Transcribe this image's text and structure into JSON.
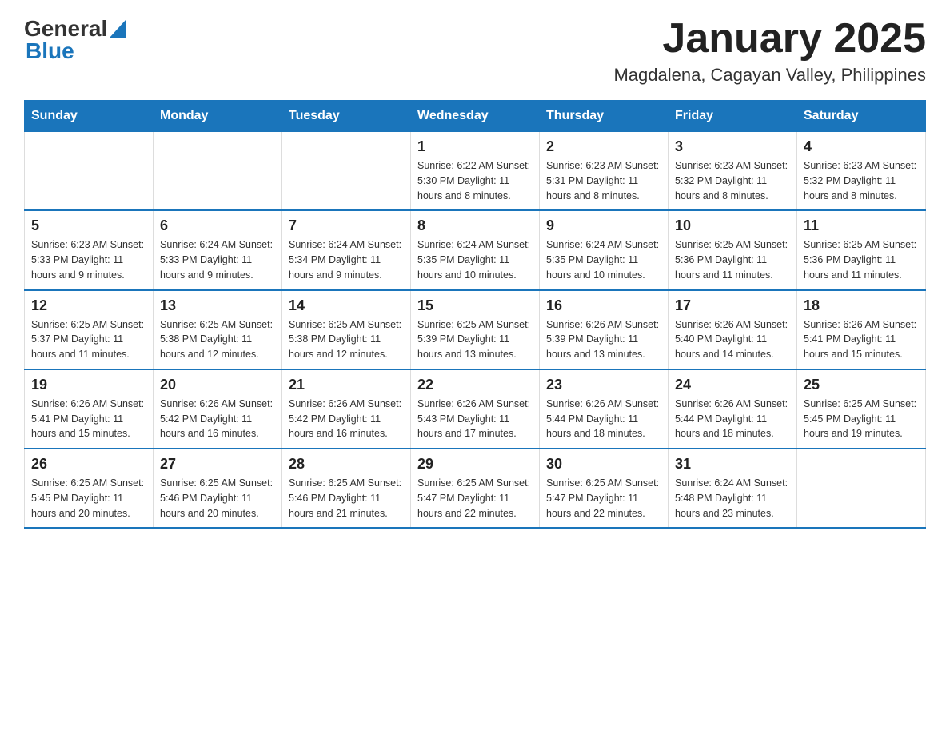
{
  "header": {
    "logo": {
      "general": "General",
      "blue": "Blue"
    },
    "title": "January 2025",
    "subtitle": "Magdalena, Cagayan Valley, Philippines"
  },
  "days_of_week": [
    "Sunday",
    "Monday",
    "Tuesday",
    "Wednesday",
    "Thursday",
    "Friday",
    "Saturday"
  ],
  "weeks": [
    [
      {
        "day": "",
        "info": ""
      },
      {
        "day": "",
        "info": ""
      },
      {
        "day": "",
        "info": ""
      },
      {
        "day": "1",
        "info": "Sunrise: 6:22 AM\nSunset: 5:30 PM\nDaylight: 11 hours and 8 minutes."
      },
      {
        "day": "2",
        "info": "Sunrise: 6:23 AM\nSunset: 5:31 PM\nDaylight: 11 hours and 8 minutes."
      },
      {
        "day": "3",
        "info": "Sunrise: 6:23 AM\nSunset: 5:32 PM\nDaylight: 11 hours and 8 minutes."
      },
      {
        "day": "4",
        "info": "Sunrise: 6:23 AM\nSunset: 5:32 PM\nDaylight: 11 hours and 8 minutes."
      }
    ],
    [
      {
        "day": "5",
        "info": "Sunrise: 6:23 AM\nSunset: 5:33 PM\nDaylight: 11 hours and 9 minutes."
      },
      {
        "day": "6",
        "info": "Sunrise: 6:24 AM\nSunset: 5:33 PM\nDaylight: 11 hours and 9 minutes."
      },
      {
        "day": "7",
        "info": "Sunrise: 6:24 AM\nSunset: 5:34 PM\nDaylight: 11 hours and 9 minutes."
      },
      {
        "day": "8",
        "info": "Sunrise: 6:24 AM\nSunset: 5:35 PM\nDaylight: 11 hours and 10 minutes."
      },
      {
        "day": "9",
        "info": "Sunrise: 6:24 AM\nSunset: 5:35 PM\nDaylight: 11 hours and 10 minutes."
      },
      {
        "day": "10",
        "info": "Sunrise: 6:25 AM\nSunset: 5:36 PM\nDaylight: 11 hours and 11 minutes."
      },
      {
        "day": "11",
        "info": "Sunrise: 6:25 AM\nSunset: 5:36 PM\nDaylight: 11 hours and 11 minutes."
      }
    ],
    [
      {
        "day": "12",
        "info": "Sunrise: 6:25 AM\nSunset: 5:37 PM\nDaylight: 11 hours and 11 minutes."
      },
      {
        "day": "13",
        "info": "Sunrise: 6:25 AM\nSunset: 5:38 PM\nDaylight: 11 hours and 12 minutes."
      },
      {
        "day": "14",
        "info": "Sunrise: 6:25 AM\nSunset: 5:38 PM\nDaylight: 11 hours and 12 minutes."
      },
      {
        "day": "15",
        "info": "Sunrise: 6:25 AM\nSunset: 5:39 PM\nDaylight: 11 hours and 13 minutes."
      },
      {
        "day": "16",
        "info": "Sunrise: 6:26 AM\nSunset: 5:39 PM\nDaylight: 11 hours and 13 minutes."
      },
      {
        "day": "17",
        "info": "Sunrise: 6:26 AM\nSunset: 5:40 PM\nDaylight: 11 hours and 14 minutes."
      },
      {
        "day": "18",
        "info": "Sunrise: 6:26 AM\nSunset: 5:41 PM\nDaylight: 11 hours and 15 minutes."
      }
    ],
    [
      {
        "day": "19",
        "info": "Sunrise: 6:26 AM\nSunset: 5:41 PM\nDaylight: 11 hours and 15 minutes."
      },
      {
        "day": "20",
        "info": "Sunrise: 6:26 AM\nSunset: 5:42 PM\nDaylight: 11 hours and 16 minutes."
      },
      {
        "day": "21",
        "info": "Sunrise: 6:26 AM\nSunset: 5:42 PM\nDaylight: 11 hours and 16 minutes."
      },
      {
        "day": "22",
        "info": "Sunrise: 6:26 AM\nSunset: 5:43 PM\nDaylight: 11 hours and 17 minutes."
      },
      {
        "day": "23",
        "info": "Sunrise: 6:26 AM\nSunset: 5:44 PM\nDaylight: 11 hours and 18 minutes."
      },
      {
        "day": "24",
        "info": "Sunrise: 6:26 AM\nSunset: 5:44 PM\nDaylight: 11 hours and 18 minutes."
      },
      {
        "day": "25",
        "info": "Sunrise: 6:25 AM\nSunset: 5:45 PM\nDaylight: 11 hours and 19 minutes."
      }
    ],
    [
      {
        "day": "26",
        "info": "Sunrise: 6:25 AM\nSunset: 5:45 PM\nDaylight: 11 hours and 20 minutes."
      },
      {
        "day": "27",
        "info": "Sunrise: 6:25 AM\nSunset: 5:46 PM\nDaylight: 11 hours and 20 minutes."
      },
      {
        "day": "28",
        "info": "Sunrise: 6:25 AM\nSunset: 5:46 PM\nDaylight: 11 hours and 21 minutes."
      },
      {
        "day": "29",
        "info": "Sunrise: 6:25 AM\nSunset: 5:47 PM\nDaylight: 11 hours and 22 minutes."
      },
      {
        "day": "30",
        "info": "Sunrise: 6:25 AM\nSunset: 5:47 PM\nDaylight: 11 hours and 22 minutes."
      },
      {
        "day": "31",
        "info": "Sunrise: 6:24 AM\nSunset: 5:48 PM\nDaylight: 11 hours and 23 minutes."
      },
      {
        "day": "",
        "info": ""
      }
    ]
  ],
  "colors": {
    "header_bg": "#1a75bb",
    "header_text": "#ffffff",
    "border": "#1a75bb"
  }
}
